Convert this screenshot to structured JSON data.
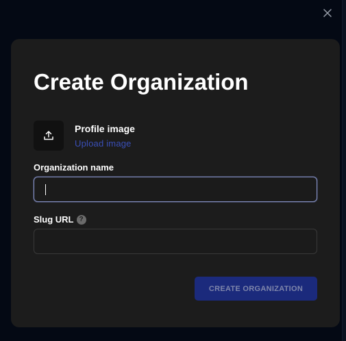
{
  "modal": {
    "title": "Create Organization",
    "profile_image_label": "Profile image",
    "upload_link": "Upload image",
    "org_name_label": "Organization name",
    "org_name_value": "",
    "slug_label": "Slug URL",
    "slug_value": "",
    "help_glyph": "?",
    "submit_label": "CREATE ORGANIZATION"
  },
  "icons": {
    "close": "close-icon",
    "upload": "upload-icon",
    "help": "help-icon"
  },
  "colors": {
    "backdrop": "#040914",
    "modal": "#1c1c1c",
    "link": "#3a4fb8",
    "button": "#1b2a7c"
  }
}
